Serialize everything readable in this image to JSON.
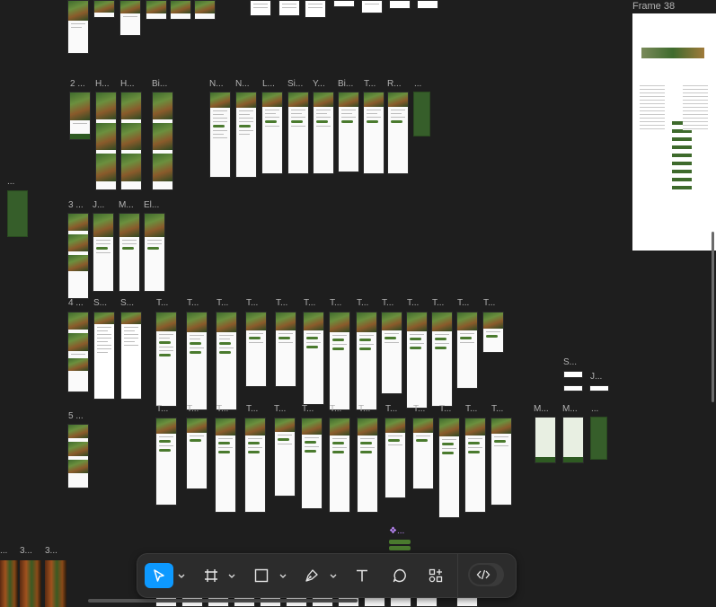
{
  "canvas": {
    "frame_title": "Frame 38",
    "section_labels": {
      "row1": "2 ...",
      "row1b": [
        "H...",
        "H...",
        "Bi..."
      ],
      "row1c": [
        "N...",
        "N...",
        "L...",
        "Si...",
        "Y...",
        "Bi...",
        "T...",
        "R...",
        "..."
      ],
      "left_dot": "...",
      "row2": "3 ...",
      "row2b": [
        "J...",
        "M...",
        "El..."
      ],
      "row3": "4 ...",
      "row3b": [
        "S...",
        "S...",
        "T...",
        "T...",
        "T...",
        "T...",
        "T...",
        "T...",
        "T...",
        "T...",
        "T...",
        "T...",
        "T...",
        "T...",
        "T..."
      ],
      "row4": "5 ...",
      "row4b": [
        "T...",
        "T...",
        "T...",
        "T...",
        "T...",
        "T...",
        "T...",
        "T...",
        "T...",
        "T...",
        "T...",
        "T...",
        "T..."
      ],
      "right_small": [
        "S...",
        "J..."
      ],
      "map_labels": [
        "M...",
        "M...",
        "..."
      ],
      "bottom_left": [
        "...",
        "3...",
        "3..."
      ],
      "component": "❖..."
    }
  },
  "toolbar": {
    "tools": [
      {
        "name": "move-tool",
        "icon": "cursor-icon",
        "active": true
      },
      {
        "name": "frame-tool",
        "icon": "frame-icon",
        "active": false
      },
      {
        "name": "shape-tool",
        "icon": "rectangle-icon",
        "active": false
      },
      {
        "name": "pen-tool",
        "icon": "pen-icon",
        "active": false
      },
      {
        "name": "text-tool",
        "icon": "text-icon",
        "active": false
      },
      {
        "name": "comment-tool",
        "icon": "comment-icon",
        "active": false
      },
      {
        "name": "actions-tool",
        "icon": "actions-icon",
        "active": false
      }
    ],
    "dev_mode_icon": "code-icon",
    "accent": "#0d99ff"
  },
  "colors": {
    "canvas_bg": "#1e1e1e",
    "brand_green": "#365e2a",
    "accent": "#0d99ff"
  }
}
